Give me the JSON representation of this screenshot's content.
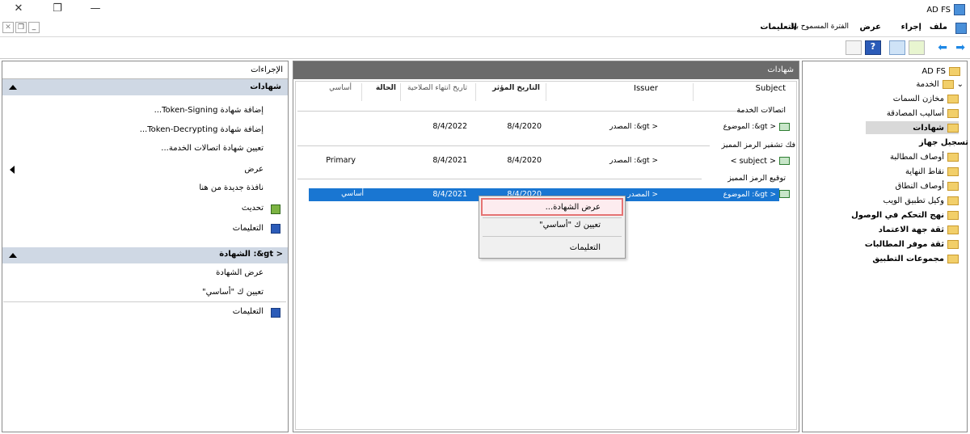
{
  "app": {
    "title": "AD FS"
  },
  "menu": {
    "file": "ملف",
    "action": "إجراء",
    "view": "عرض",
    "window": "الفترة المسموح بها",
    "help": "التعليمات"
  },
  "tree": {
    "root": "AD FS",
    "service": "الخدمة",
    "items": [
      "مخازن السمات",
      "أساليب المصادقة",
      "شهادات",
      "تسجيل جهاز",
      "أوصاف المطالبة",
      "نقاط النهاية",
      "أوصاف النطاق",
      "وكيل تطبيق الويب"
    ],
    "others": [
      "نهج التحكم في الوصول",
      "ثقة جهة الاعتماد",
      "ثقة موفر المطالبات",
      "مجموعات التطبيق"
    ]
  },
  "center": {
    "header": "شهادات",
    "columns": {
      "subject": "Subject",
      "issuer": "Issuer",
      "effective": "التاريخ المؤثر",
      "expiry": "تاريخ انتهاء الصلاحية",
      "status": "الحالة",
      "primary": "أساسي"
    },
    "groups": [
      "اتصالات الخدمة",
      "فك تشفير الرمز المميز",
      "توقيع الرمز المميز"
    ],
    "rows": [
      {
        "subject": "< gt&: الموضوع",
        "issuer": "< gt&: المصدر",
        "effective": "8/4/2020",
        "expiry": "8/4/2022",
        "primary": ""
      },
      {
        "subject": "< subject >",
        "issuer": "< gt&: المصدر",
        "effective": "8/4/2020",
        "expiry": "8/4/2021",
        "primary": "Primary"
      },
      {
        "subject": "< gt&: الموضوع",
        "issuer": "< المصدر",
        "effective": "8/4/2020",
        "expiry": "8/4/2021",
        "primary": "أساسي"
      }
    ]
  },
  "context_menu": {
    "items": [
      "عرض الشهادة...",
      "تعيين ك \"أساسي\"",
      "التعليمات"
    ]
  },
  "actions": {
    "title": "الإجراءات",
    "section1": "شهادات",
    "items1": [
      "إضافة شهادة Token-Signing...",
      "إضافة شهادة Token-Decrypting...",
      "تعيين شهادة اتصالات الخدمة...",
      "عرض",
      "نافذة جديدة من هنا",
      "تحديث",
      "التعليمات"
    ],
    "section2": "< gt&: الشهادة",
    "items2": [
      "عرض الشهادة",
      "تعيين ك \"أساسي\"",
      "التعليمات"
    ]
  }
}
